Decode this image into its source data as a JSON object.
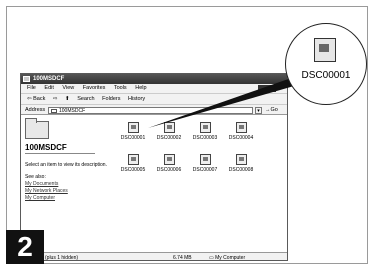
{
  "window": {
    "title": "100MSDCF",
    "menu": [
      "File",
      "Edit",
      "View",
      "Favorites",
      "Tools",
      "Help"
    ],
    "toolbar": [
      "⇦ Back",
      "⇨",
      "⬆",
      "Search",
      "Folders",
      "History"
    ],
    "address_label": "Address",
    "address_value": "100MSDCF",
    "go_label": "Go"
  },
  "left_pane": {
    "folder_title": "100MSDCF",
    "hint": "Select an item to view its description.",
    "see_also": "See also:",
    "links": [
      "My Documents",
      "My Network Places",
      "My Computer"
    ]
  },
  "files": [
    "DSC00001",
    "DSC00002",
    "DSC00003",
    "DSC00004",
    "DSC00005",
    "DSC00006",
    "DSC00007",
    "DSC00008"
  ],
  "status": {
    "left": "(plus 1 hidden)",
    "size": "6.74 MB",
    "location": "My Computer"
  },
  "callout": {
    "label": "DSC00001"
  },
  "step": "2"
}
